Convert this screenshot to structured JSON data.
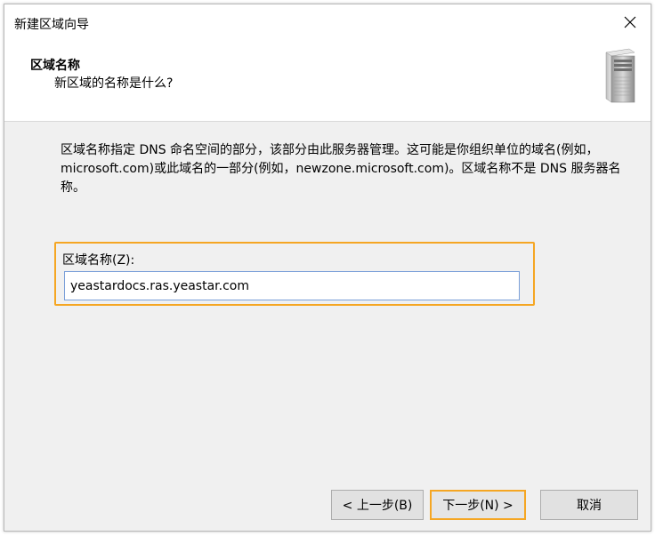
{
  "window": {
    "title": "新建区域向导"
  },
  "header": {
    "title": "区域名称",
    "subtitle": "新区域的名称是什么?"
  },
  "body": {
    "description": "区域名称指定 DNS 命名空间的部分，该部分由此服务器管理。这可能是你组织单位的域名(例如，microsoft.com)或此域名的一部分(例如，newzone.microsoft.com)。区域名称不是 DNS 服务器名称。",
    "zone_name_label": "区域名称(Z):",
    "zone_name_value": "yeastardocs.ras.yeastar.com"
  },
  "buttons": {
    "back": "< 上一步(B)",
    "next": "下一步(N) >",
    "cancel": "取消"
  },
  "icons": {
    "close": "close-icon",
    "server": "server-icon"
  },
  "colors": {
    "highlight": "#f5a623",
    "input_border": "#7a9fd8",
    "dialog_bg": "#f0f0f0"
  }
}
